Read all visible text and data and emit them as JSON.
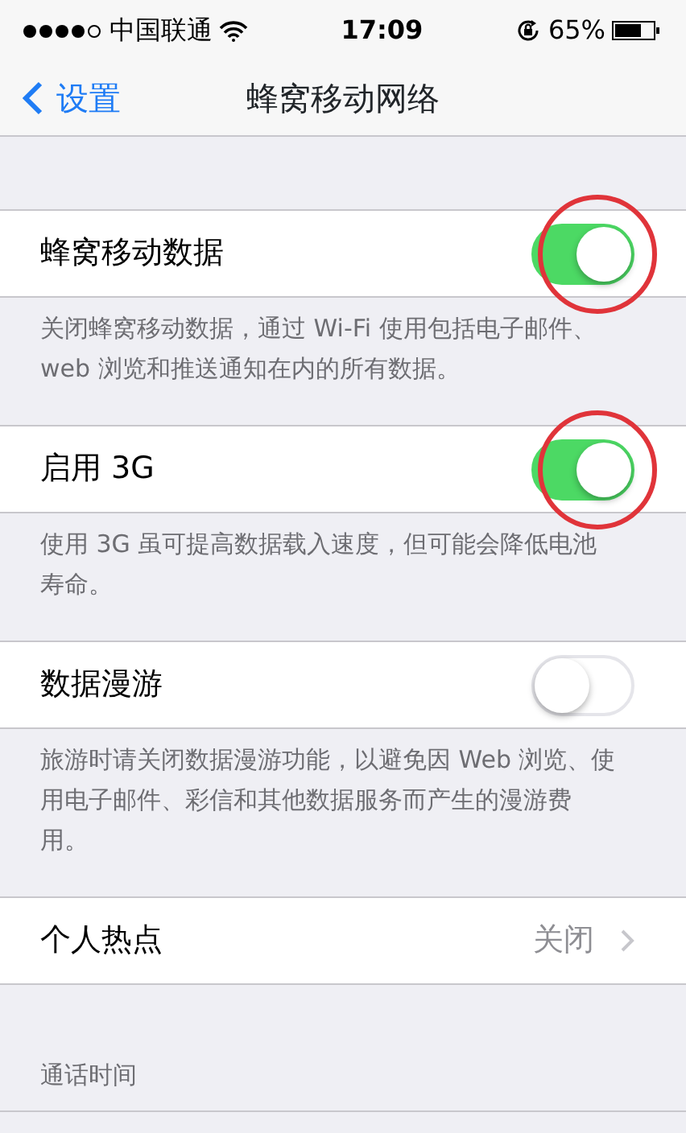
{
  "status_bar": {
    "carrier": "中国联通",
    "time": "17:09",
    "battery": "65%"
  },
  "nav_bar": {
    "back": "设置",
    "title": "蜂窝移动网络"
  },
  "groups": [
    {
      "rows": [
        {
          "kind": "toggle",
          "label": "蜂窝移动数据",
          "on": true,
          "highlighted": true
        }
      ],
      "footer": "关闭蜂窝移动数据，通过 Wi-Fi 使用包括电子邮件、web 浏览和推送通知在内的所有数据。"
    },
    {
      "rows": [
        {
          "kind": "toggle",
          "label": "启用 3G",
          "on": true,
          "highlighted": true
        }
      ],
      "footer": "使用 3G 虽可提高数据载入速度，但可能会降低电池寿命。"
    },
    {
      "rows": [
        {
          "kind": "toggle",
          "label": "数据漫游",
          "on": false,
          "highlighted": false
        }
      ],
      "footer": "旅游时请关闭数据漫游功能，以避免因 Web 浏览、使用电子邮件、彩信和其他数据服务而产生的漫游费用。"
    },
    {
      "rows": [
        {
          "kind": "link",
          "label": "个人热点",
          "value": "关闭"
        }
      ]
    },
    {
      "header": "通话时间"
    }
  ]
}
